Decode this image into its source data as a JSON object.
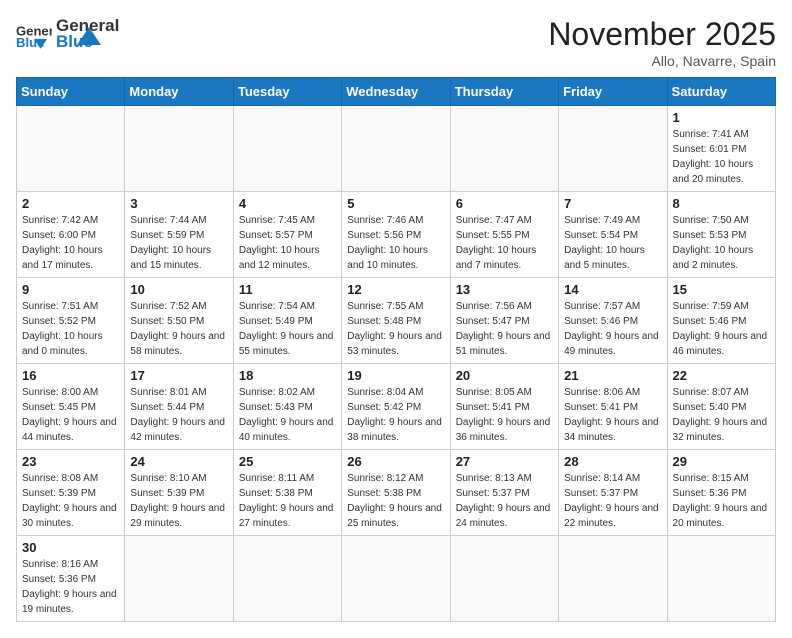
{
  "header": {
    "logo_general": "General",
    "logo_blue": "Blue",
    "month_title": "November 2025",
    "location": "Allo, Navarre, Spain"
  },
  "days_of_week": [
    "Sunday",
    "Monday",
    "Tuesday",
    "Wednesday",
    "Thursday",
    "Friday",
    "Saturday"
  ],
  "weeks": [
    [
      {
        "day": "",
        "info": ""
      },
      {
        "day": "",
        "info": ""
      },
      {
        "day": "",
        "info": ""
      },
      {
        "day": "",
        "info": ""
      },
      {
        "day": "",
        "info": ""
      },
      {
        "day": "",
        "info": ""
      },
      {
        "day": "1",
        "info": "Sunrise: 7:41 AM\nSunset: 6:01 PM\nDaylight: 10 hours and 20 minutes."
      }
    ],
    [
      {
        "day": "2",
        "info": "Sunrise: 7:42 AM\nSunset: 6:00 PM\nDaylight: 10 hours and 17 minutes."
      },
      {
        "day": "3",
        "info": "Sunrise: 7:44 AM\nSunset: 5:59 PM\nDaylight: 10 hours and 15 minutes."
      },
      {
        "day": "4",
        "info": "Sunrise: 7:45 AM\nSunset: 5:57 PM\nDaylight: 10 hours and 12 minutes."
      },
      {
        "day": "5",
        "info": "Sunrise: 7:46 AM\nSunset: 5:56 PM\nDaylight: 10 hours and 10 minutes."
      },
      {
        "day": "6",
        "info": "Sunrise: 7:47 AM\nSunset: 5:55 PM\nDaylight: 10 hours and 7 minutes."
      },
      {
        "day": "7",
        "info": "Sunrise: 7:49 AM\nSunset: 5:54 PM\nDaylight: 10 hours and 5 minutes."
      },
      {
        "day": "8",
        "info": "Sunrise: 7:50 AM\nSunset: 5:53 PM\nDaylight: 10 hours and 2 minutes."
      }
    ],
    [
      {
        "day": "9",
        "info": "Sunrise: 7:51 AM\nSunset: 5:52 PM\nDaylight: 10 hours and 0 minutes."
      },
      {
        "day": "10",
        "info": "Sunrise: 7:52 AM\nSunset: 5:50 PM\nDaylight: 9 hours and 58 minutes."
      },
      {
        "day": "11",
        "info": "Sunrise: 7:54 AM\nSunset: 5:49 PM\nDaylight: 9 hours and 55 minutes."
      },
      {
        "day": "12",
        "info": "Sunrise: 7:55 AM\nSunset: 5:48 PM\nDaylight: 9 hours and 53 minutes."
      },
      {
        "day": "13",
        "info": "Sunrise: 7:56 AM\nSunset: 5:47 PM\nDaylight: 9 hours and 51 minutes."
      },
      {
        "day": "14",
        "info": "Sunrise: 7:57 AM\nSunset: 5:46 PM\nDaylight: 9 hours and 49 minutes."
      },
      {
        "day": "15",
        "info": "Sunrise: 7:59 AM\nSunset: 5:46 PM\nDaylight: 9 hours and 46 minutes."
      }
    ],
    [
      {
        "day": "16",
        "info": "Sunrise: 8:00 AM\nSunset: 5:45 PM\nDaylight: 9 hours and 44 minutes."
      },
      {
        "day": "17",
        "info": "Sunrise: 8:01 AM\nSunset: 5:44 PM\nDaylight: 9 hours and 42 minutes."
      },
      {
        "day": "18",
        "info": "Sunrise: 8:02 AM\nSunset: 5:43 PM\nDaylight: 9 hours and 40 minutes."
      },
      {
        "day": "19",
        "info": "Sunrise: 8:04 AM\nSunset: 5:42 PM\nDaylight: 9 hours and 38 minutes."
      },
      {
        "day": "20",
        "info": "Sunrise: 8:05 AM\nSunset: 5:41 PM\nDaylight: 9 hours and 36 minutes."
      },
      {
        "day": "21",
        "info": "Sunrise: 8:06 AM\nSunset: 5:41 PM\nDaylight: 9 hours and 34 minutes."
      },
      {
        "day": "22",
        "info": "Sunrise: 8:07 AM\nSunset: 5:40 PM\nDaylight: 9 hours and 32 minutes."
      }
    ],
    [
      {
        "day": "23",
        "info": "Sunrise: 8:08 AM\nSunset: 5:39 PM\nDaylight: 9 hours and 30 minutes."
      },
      {
        "day": "24",
        "info": "Sunrise: 8:10 AM\nSunset: 5:39 PM\nDaylight: 9 hours and 29 minutes."
      },
      {
        "day": "25",
        "info": "Sunrise: 8:11 AM\nSunset: 5:38 PM\nDaylight: 9 hours and 27 minutes."
      },
      {
        "day": "26",
        "info": "Sunrise: 8:12 AM\nSunset: 5:38 PM\nDaylight: 9 hours and 25 minutes."
      },
      {
        "day": "27",
        "info": "Sunrise: 8:13 AM\nSunset: 5:37 PM\nDaylight: 9 hours and 24 minutes."
      },
      {
        "day": "28",
        "info": "Sunrise: 8:14 AM\nSunset: 5:37 PM\nDaylight: 9 hours and 22 minutes."
      },
      {
        "day": "29",
        "info": "Sunrise: 8:15 AM\nSunset: 5:36 PM\nDaylight: 9 hours and 20 minutes."
      }
    ],
    [
      {
        "day": "30",
        "info": "Sunrise: 8:16 AM\nSunset: 5:36 PM\nDaylight: 9 hours and 19 minutes."
      },
      {
        "day": "",
        "info": ""
      },
      {
        "day": "",
        "info": ""
      },
      {
        "day": "",
        "info": ""
      },
      {
        "day": "",
        "info": ""
      },
      {
        "day": "",
        "info": ""
      },
      {
        "day": "",
        "info": ""
      }
    ]
  ]
}
